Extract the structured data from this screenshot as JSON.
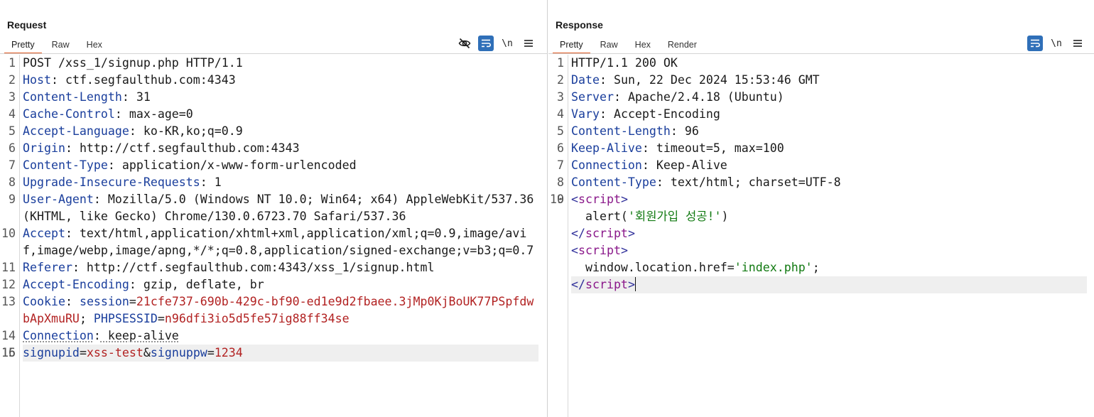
{
  "view_toggle": {
    "icons": [
      "split-vertical-icon",
      "split-horizontal-icon",
      "single-pane-icon"
    ],
    "active": 0
  },
  "request": {
    "title": "Request",
    "tabs": [
      "Pretty",
      "Raw",
      "Hex"
    ],
    "active_tab": 0,
    "tools": {
      "hide_icon": "eye-slash-icon",
      "wrap_icon": "word-wrap-icon",
      "newline_label": "\\n",
      "menu_icon": "hamburger-menu-icon"
    },
    "lines": [
      {
        "num": "1",
        "text": "POST /xss_1/signup.php HTTP/1.1"
      },
      {
        "num": "2",
        "name": "Host",
        "value": " ctf.segfaulthub.com:4343"
      },
      {
        "num": "3",
        "name": "Content-Length",
        "value": " 31"
      },
      {
        "num": "4",
        "name": "Cache-Control",
        "value": " max-age=0"
      },
      {
        "num": "5",
        "name": "Accept-Language",
        "value": " ko-KR,ko;q=0.9"
      },
      {
        "num": "6",
        "name": "Origin",
        "value": " http://ctf.segfaulthub.com:4343"
      },
      {
        "num": "7",
        "name": "Content-Type",
        "value": " application/x-www-form-urlencoded"
      },
      {
        "num": "8",
        "name": "Upgrade-Insecure-Requests",
        "value": " 1"
      },
      {
        "num": "9",
        "name": "User-Agent",
        "value": " Mozilla/5.0 (Windows NT 10.0; Win64; x64) AppleWebKit/537.36 (KHTML, like Gecko) Chrome/130.0.6723.70 Safari/537.36"
      },
      {
        "num": "10",
        "name": "Accept",
        "value": " text/html,application/xhtml+xml,application/xml;q=0.9,image/avif,image/webp,image/apng,*/*;q=0.8,application/signed-exchange;v=b3;q=0.7"
      },
      {
        "num": "11",
        "name": "Referer",
        "value": " http://ctf.segfaulthub.com:4343/xss_1/signup.html"
      },
      {
        "num": "12",
        "name": "Accept-Encoding",
        "value": " gzip, deflate, br"
      },
      {
        "num": "13",
        "name": "Cookie",
        "cookie": [
          {
            "name": "session",
            "value": "21cfe737-690b-429c-bf90-ed1e9d2fbaee.3jMp0KjBoUK77PSpfdwbApXmuRU"
          },
          {
            "name": "PHPSESSID",
            "value": "n96dfi3io5d5fe57ig88ff34se"
          }
        ]
      },
      {
        "num": "14",
        "name": "Connection",
        "value": " keep-alive",
        "underline": true
      },
      {
        "num": "15",
        "text": ""
      },
      {
        "num": "16",
        "params": [
          {
            "name": "signupid",
            "value": "xss-test"
          },
          {
            "name": "signuppw",
            "value": "1234"
          }
        ],
        "highlight": true
      }
    ]
  },
  "response": {
    "title": "Response",
    "tabs": [
      "Pretty",
      "Raw",
      "Hex",
      "Render"
    ],
    "active_tab": 0,
    "tools": {
      "wrap_icon": "word-wrap-icon",
      "newline_label": "\\n",
      "menu_icon": "hamburger-menu-icon"
    },
    "lines": [
      {
        "num": "1",
        "text": "HTTP/1.1 200 OK"
      },
      {
        "num": "2",
        "name": "Date",
        "value": " Sun, 22 Dec 2024 15:53:46 GMT"
      },
      {
        "num": "3",
        "name": "Server",
        "value": " Apache/2.4.18 (Ubuntu)"
      },
      {
        "num": "4",
        "name": "Vary",
        "value": " Accept-Encoding"
      },
      {
        "num": "5",
        "name": "Content-Length",
        "value": " 96"
      },
      {
        "num": "6",
        "name": "Keep-Alive",
        "value": " timeout=5, max=100"
      },
      {
        "num": "7",
        "name": "Connection",
        "value": " Keep-Alive"
      },
      {
        "num": "8",
        "name": "Content-Type",
        "value": " text/html; charset=UTF-8"
      },
      {
        "num": "9",
        "text": ""
      },
      {
        "num": "10",
        "html": [
          [
            {
              "t": "tag",
              "s": "<"
            },
            {
              "t": "name",
              "s": "script"
            },
            {
              "t": "tag",
              "s": ">"
            }
          ],
          [
            {
              "t": "plain",
              "s": "  alert("
            },
            {
              "t": "str",
              "s": "'회원가입 성공!'"
            },
            {
              "t": "plain",
              "s": ")"
            }
          ],
          [
            {
              "t": "tag",
              "s": "</"
            },
            {
              "t": "name",
              "s": "script"
            },
            {
              "t": "tag",
              "s": ">"
            }
          ],
          [
            {
              "t": "tag",
              "s": "<"
            },
            {
              "t": "name",
              "s": "script"
            },
            {
              "t": "tag",
              "s": ">"
            }
          ],
          [
            {
              "t": "plain",
              "s": "  window.location.href="
            },
            {
              "t": "str",
              "s": "'index.php'"
            },
            {
              "t": "plain",
              "s": ";"
            }
          ],
          [
            {
              "t": "tag",
              "s": "</"
            },
            {
              "t": "name",
              "s": "script"
            },
            {
              "t": "tag",
              "s": ">"
            },
            {
              "t": "caret",
              "s": ""
            }
          ]
        ]
      }
    ]
  }
}
